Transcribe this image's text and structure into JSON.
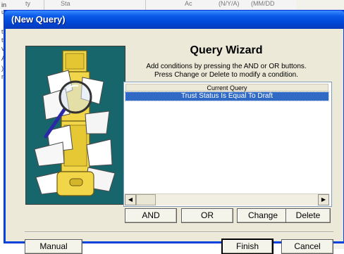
{
  "background": {
    "header_fragments": [
      "ty",
      "Sta",
      "Ac",
      "(N/Y/A)",
      "(MM/DD"
    ],
    "left_fragments": [
      "in",
      "uy",
      "t",
      "tth",
      "va",
      "A",
      "),",
      "ne"
    ]
  },
  "dialog": {
    "title": "(New Query)",
    "heading": "Query Wizard",
    "instruction_line1": "Add conditions by pressing the AND or OR buttons.",
    "instruction_line2": "Press Change or Delete to modify a condition.",
    "query_list": {
      "header": "Current Query",
      "rows": [
        "Trust Status Is Equal To Draft"
      ]
    },
    "buttons": {
      "and": "AND",
      "or": "OR",
      "change": "Change",
      "delete": "Delete",
      "manual": "Manual",
      "finish": "Finish",
      "cancel": "Cancel"
    }
  },
  "colors": {
    "title_bar": "#0a5ae8",
    "selection": "#316ac5",
    "dialog_face": "#ece9d8",
    "image_background": "#17666c"
  },
  "icons": [
    "magnifying-glass-icon",
    "file-cabinet-icon",
    "scroll-left-icon",
    "scroll-right-icon"
  ]
}
